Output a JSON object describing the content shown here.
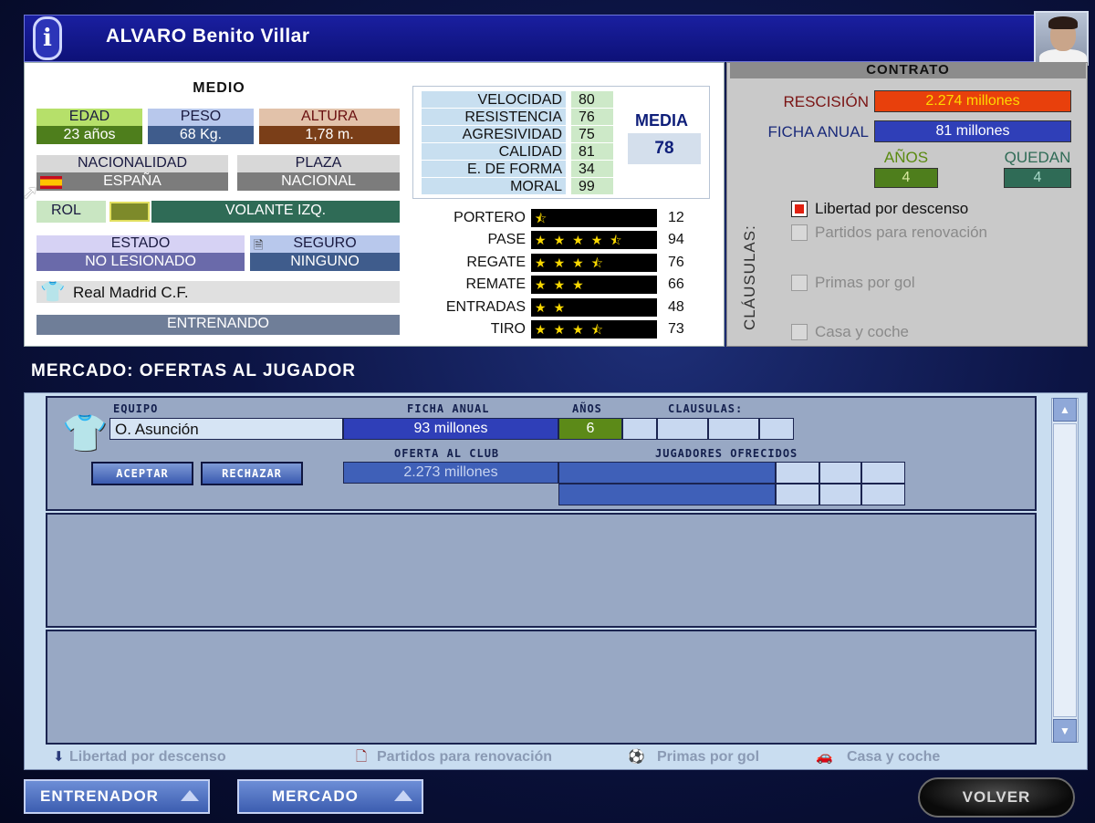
{
  "player": {
    "name": "ALVARO Benito Villar",
    "position": "MEDIO",
    "age_label": "EDAD",
    "age": "23 años",
    "weight_label": "PESO",
    "weight": "68 Kg.",
    "height_label": "ALTURA",
    "height": "1,78 m.",
    "nationality_label": "NACIONALIDAD",
    "nationality": "ESPAÑA",
    "place_label": "PLAZA",
    "place": "NACIONAL",
    "role_label": "ROL",
    "role": "VOLANTE IZQ.",
    "status_label": "ESTADO",
    "status": "NO LESIONADO",
    "insurance_label": "SEGURO",
    "insurance": "NINGUNO",
    "club": "Real Madrid C.F.",
    "activity": "ENTRENANDO",
    "colors": {
      "age": "#4e7e1c",
      "weight": "#3f5c8c",
      "height": "#7a3e18"
    }
  },
  "attributes": [
    {
      "name": "VELOCIDAD",
      "value": "80"
    },
    {
      "name": "RESISTENCIA",
      "value": "76"
    },
    {
      "name": "AGRESIVIDAD",
      "value": "75"
    },
    {
      "name": "CALIDAD",
      "value": "81"
    },
    {
      "name": "E. DE FORMA",
      "value": "34"
    },
    {
      "name": "MORAL",
      "value": "99"
    }
  ],
  "media": {
    "label": "MEDIA",
    "value": "78"
  },
  "skills": [
    {
      "name": "PORTERO",
      "value": "12",
      "stars": 0.5
    },
    {
      "name": "PASE",
      "value": "94",
      "stars": 4.5
    },
    {
      "name": "REGATE",
      "value": "76",
      "stars": 3.5
    },
    {
      "name": "REMATE",
      "value": "66",
      "stars": 3
    },
    {
      "name": "ENTRADAS",
      "value": "48",
      "stars": 2
    },
    {
      "name": "TIRO",
      "value": "73",
      "stars": 3.5
    }
  ],
  "contract": {
    "title": "CONTRATO",
    "rescission_label": "RESCISIÓN",
    "rescission": "2.274 millones",
    "salary_label": "FICHA ANUAL",
    "salary": "81 millones",
    "years_label": "AÑOS",
    "years": "4",
    "remaining_label": "QUEDAN",
    "remaining": "4",
    "clauses_label": "CLÁUSULAS:",
    "clauses": [
      {
        "label": "Libertad por descenso",
        "checked": true
      },
      {
        "label": "Partidos para renovación",
        "checked": false
      },
      {
        "label": "Primas por gol",
        "checked": false
      },
      {
        "label": "Casa y coche",
        "checked": false
      }
    ]
  },
  "market": {
    "title": "MERCADO: OFERTAS AL JUGADOR",
    "hdr_team": "EQUIPO",
    "hdr_salary": "FICHA ANUAL",
    "hdr_years": "AÑOS",
    "hdr_clauses": "CLAUSULAS:",
    "hdr_offer": "OFERTA AL CLUB",
    "hdr_players": "JUGADORES OFRECIDOS",
    "offer": {
      "team": "O. Asunción",
      "salary": "93 millones",
      "years": "6",
      "club_offer": "2.273 millones"
    },
    "accept": "ACEPTAR",
    "reject": "RECHAZAR"
  },
  "legend": {
    "relegation": "Libertad por descenso",
    "renewal": "Partidos para renovación",
    "goal_bonus": "Primas por gol",
    "house_car": "Casa y coche"
  },
  "nav": {
    "coach": "ENTRENADOR",
    "market": "MERCADO",
    "back": "VOLVER"
  }
}
